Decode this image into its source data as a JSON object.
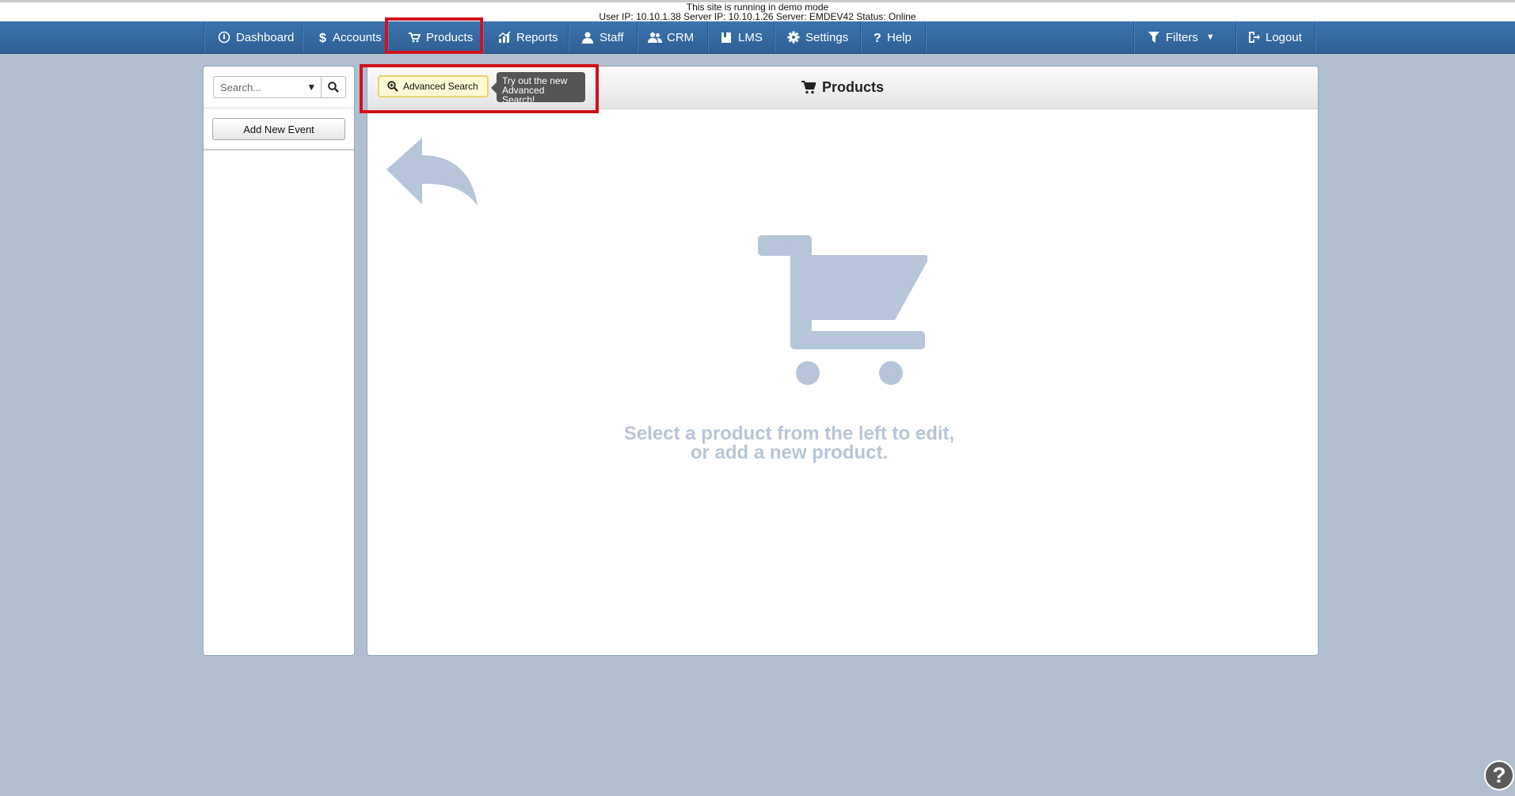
{
  "banner": {
    "line1": "This site is running in demo mode",
    "line2": "User IP: 10.10.1.38 Server IP: 10.10.1.26 Server: EMDEV42 Status: Online"
  },
  "nav": {
    "items": [
      {
        "label": "Dashboard",
        "icon": "dashboard-icon"
      },
      {
        "label": "Accounts",
        "icon": "dollar-icon"
      },
      {
        "label": "Products",
        "icon": "cart-icon"
      },
      {
        "label": "Reports",
        "icon": "chart-icon"
      },
      {
        "label": "Staff",
        "icon": "person-icon"
      },
      {
        "label": "CRM",
        "icon": "people-icon"
      },
      {
        "label": "LMS",
        "icon": "book-icon"
      },
      {
        "label": "Settings",
        "icon": "gear-icon"
      },
      {
        "label": "Help",
        "icon": "question-icon"
      }
    ],
    "filters_label": "Filters",
    "logout_label": "Logout"
  },
  "sidebar": {
    "search_placeholder": "Search...",
    "add_button": "Add New Event"
  },
  "main": {
    "title": "Products",
    "advanced_search_label": "Advanced Search",
    "tooltip_line1": "Try out the new",
    "tooltip_line2": "Advanced Search!",
    "empty_line1": "Select a product from the left to edit,",
    "empty_line2": "or add a new product."
  },
  "help_fab": "?",
  "colors": {
    "nav_bg": "#3468a0",
    "page_bg": "#b0bfd0",
    "highlight": "#d0121c",
    "placeholder_graphic": "#b7c5d8"
  }
}
